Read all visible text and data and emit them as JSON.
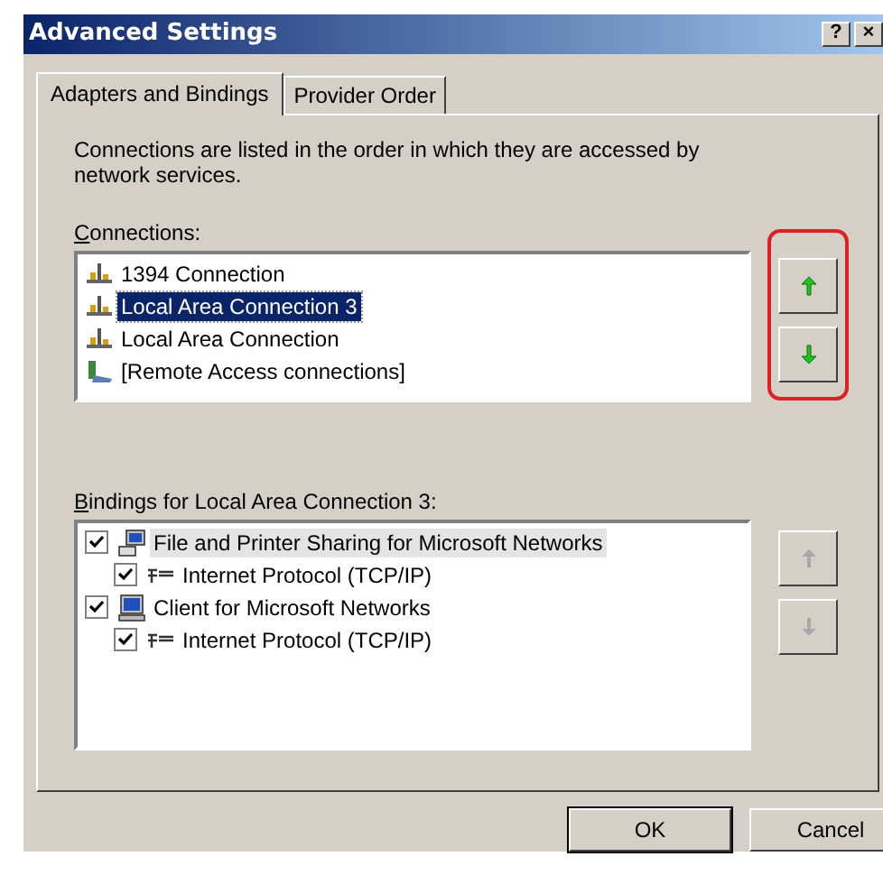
{
  "window": {
    "title": "Advanced Settings",
    "help_button": "?",
    "close_button": "×"
  },
  "tabs": [
    {
      "label": "Adapters and Bindings",
      "selected": true
    },
    {
      "label": "Provider Order",
      "selected": false
    }
  ],
  "description": "Connections are listed in the order in which they are accessed by network services.",
  "connections": {
    "label": "Connections:",
    "items": [
      {
        "name": "1394 Connection",
        "kind": "lan",
        "selected": false
      },
      {
        "name": "Local Area Connection 3",
        "kind": "lan",
        "selected": true
      },
      {
        "name": "Local Area Connection",
        "kind": "lan",
        "selected": false
      },
      {
        "name": "[Remote Access connections]",
        "kind": "remote",
        "selected": false
      }
    ],
    "move_buttons": [
      {
        "kind": "up",
        "disabled": false
      },
      {
        "kind": "down",
        "disabled": false
      }
    ],
    "highlighted": true
  },
  "bindings": {
    "label": "Bindings for Local Area Connection 3:",
    "items": [
      {
        "name": "File and Printer Sharing for Microsoft Networks",
        "kind": "service",
        "checked": true,
        "selected": true,
        "children": [
          {
            "name": "Internet Protocol (TCP/IP)",
            "kind": "protocol",
            "checked": true,
            "selected": false
          }
        ]
      },
      {
        "name": "Client for Microsoft Networks",
        "kind": "client",
        "checked": true,
        "selected": false,
        "children": [
          {
            "name": "Internet Protocol (TCP/IP)",
            "kind": "protocol",
            "checked": true,
            "selected": false
          }
        ]
      }
    ],
    "move_buttons": [
      {
        "kind": "up",
        "disabled": true
      },
      {
        "kind": "down",
        "disabled": true
      }
    ]
  },
  "buttons": [
    {
      "label": "OK",
      "default": true
    },
    {
      "label": "Cancel",
      "default": false
    }
  ]
}
